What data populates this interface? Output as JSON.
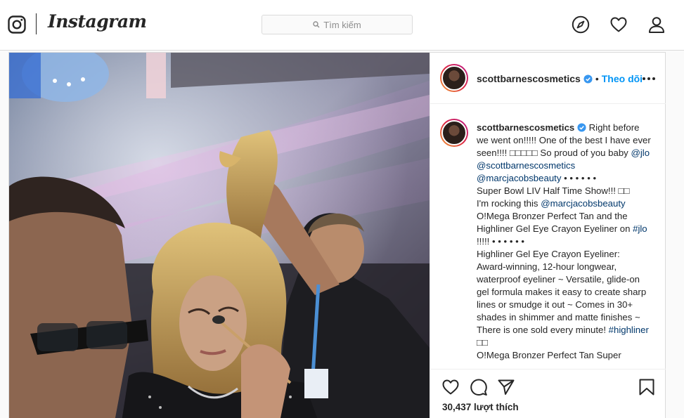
{
  "header": {
    "brand": "Instagram",
    "search_placeholder": "Tìm kiếm"
  },
  "post": {
    "username": "scottbarnescosmetics",
    "follow_label": "Theo dõi",
    "caption": {
      "username": "scottbarnescosmetics",
      "text_1": "Right before we went on!!!!! One of the best I have ever seen!!!! □□□□□ So proud of you baby ",
      "mention_jlo": "@jlo",
      "mention_scott": "@scottbarnescosmetics",
      "mention_marc": "@marcjacobsbeauty",
      "dots_1": " • • • • • •",
      "text_2": "Super Bowl LIV Half Time Show!!! □□",
      "text_3": "I'm rocking this ",
      "mention_marc2": "@marcjacobsbeauty",
      "text_4": " O!Mega Bronzer Perfect Tan and the Highliner Gel Eye Crayon Eyeliner on ",
      "hashtag_jlo": "#jlo",
      "dots_2": " !!!!! • • • • • •",
      "text_5": "Highliner Gel Eye Crayon Eyeliner: Award-winning, 12-hour longwear, waterproof eyeliner ~ Versatile, glide-on gel formula makes it easy to create sharp lines or smudge it out ~ Comes in 30+ shades in shimmer and matte finishes ~ There is one sold every minute! ",
      "hashtag_highliner": "#highliner",
      "text_6": "□□",
      "text_7": "O!Mega Bronzer Perfect Tan Super"
    },
    "likes": "30,437 lượt thích"
  },
  "icons": {
    "logo": "instagram-glyph-icon",
    "search": "search-icon",
    "explore": "compass-icon",
    "activity": "heart-icon",
    "profile": "user-icon",
    "verified": "verified-badge-icon",
    "more": "more-options-icon",
    "like": "heart-outline-icon",
    "comment": "comment-icon",
    "share": "paper-plane-icon",
    "save": "bookmark-icon"
  },
  "colors": {
    "link_blue": "#0095f6",
    "mention": "#00376b",
    "border": "#dbdbdb",
    "text": "#262626"
  }
}
